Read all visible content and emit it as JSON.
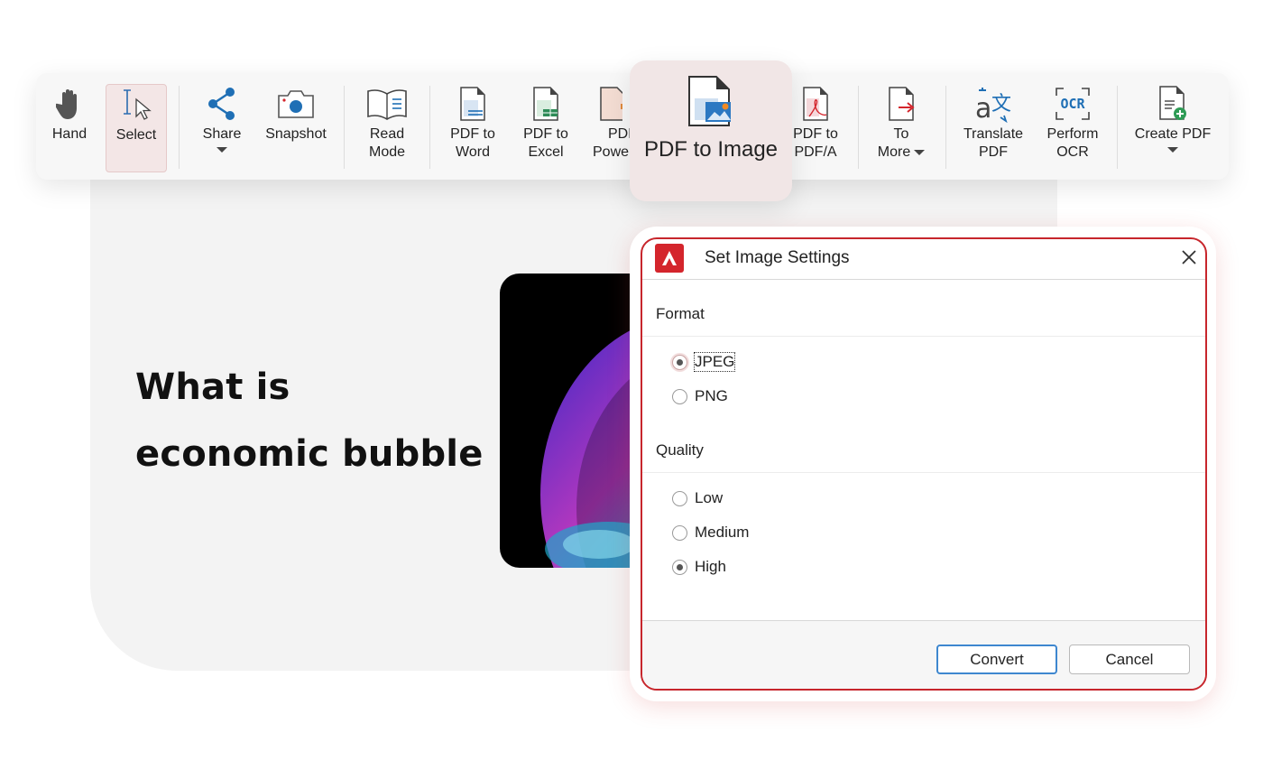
{
  "document": {
    "title_line1": "What is",
    "title_line2": "economic bubble"
  },
  "toolbar": {
    "items": [
      {
        "label": "Hand",
        "icon": "hand-icon"
      },
      {
        "label": "Select",
        "icon": "text-cursor-icon",
        "active": true
      },
      {
        "label": "Share",
        "icon": "share-icon",
        "dropdown": true
      },
      {
        "label": "Snapshot",
        "icon": "camera-icon"
      },
      {
        "label1": "Read",
        "label2": "Mode",
        "icon": "book-icon"
      },
      {
        "label1": "PDF to",
        "label2": "Word",
        "icon": "pdf-to-word-icon"
      },
      {
        "label1": "PDF to",
        "label2": "Excel",
        "icon": "pdf-to-excel-icon"
      },
      {
        "label1": "PDF",
        "label2": "Powe",
        "icon": "pdf-to-powerpoint-icon"
      },
      {
        "label": "PDF to Image",
        "icon": "pdf-to-image-icon",
        "highlighted": true
      },
      {
        "label1": "PDF to",
        "label2": "PDF/A",
        "icon": "pdf-to-pdfa-icon"
      },
      {
        "label1": "To",
        "label2": "More",
        "icon": "export-icon",
        "dropdown": true
      },
      {
        "label1": "Translate",
        "label2": "PDF",
        "icon": "translate-icon"
      },
      {
        "label1": "Perform",
        "label2": "OCR",
        "icon": "ocr-icon",
        "icon_text": "OCR"
      },
      {
        "label": "Create PDF",
        "icon": "create-pdf-icon",
        "dropdown": true
      }
    ]
  },
  "dialog": {
    "title": "Set Image Settings",
    "format": {
      "label": "Format",
      "options": [
        {
          "label": "JPEG",
          "selected": true
        },
        {
          "label": "PNG",
          "selected": false
        }
      ]
    },
    "quality": {
      "label": "Quality",
      "options": [
        {
          "label": "Low",
          "selected": false
        },
        {
          "label": "Medium",
          "selected": false
        },
        {
          "label": "High",
          "selected": true
        }
      ]
    },
    "convert_label": "Convert",
    "cancel_label": "Cancel"
  },
  "colors": {
    "accent_red": "#c7262c",
    "ocr_blue": "#1f6fb5",
    "primary_button_border": "#3e87cf"
  }
}
